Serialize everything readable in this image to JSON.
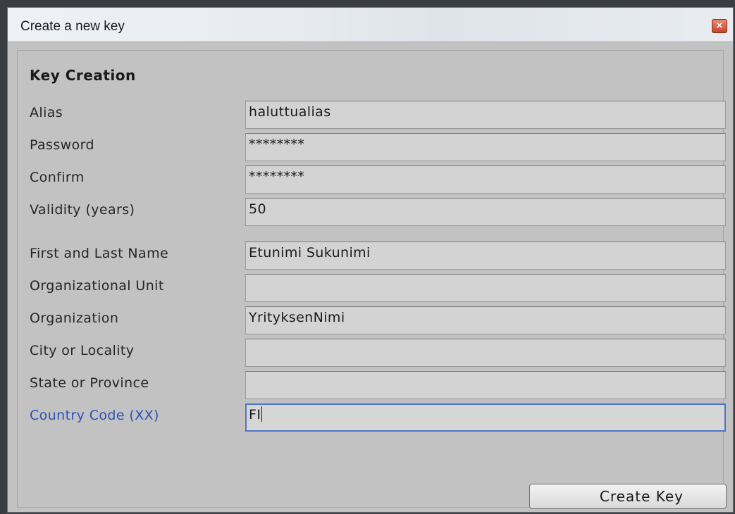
{
  "window": {
    "title": "Create a new key",
    "close_glyph": "×"
  },
  "section": {
    "heading": "Key Creation"
  },
  "fields": [
    {
      "label": "Alias",
      "value": "haluttualias"
    },
    {
      "label": "Password",
      "value": "********"
    },
    {
      "label": "Confirm",
      "value": "********"
    },
    {
      "label": "Validity (years)",
      "value": "50"
    },
    {
      "label": "First and Last Name",
      "value": "Etunimi Sukunimi"
    },
    {
      "label": "Organizational Unit",
      "value": ""
    },
    {
      "label": "Organization",
      "value": "YrityksenNimi"
    },
    {
      "label": "City or Locality",
      "value": ""
    },
    {
      "label": "State or Province",
      "value": ""
    },
    {
      "label": "Country Code (XX)",
      "value": "FI",
      "focused": true
    }
  ],
  "actions": {
    "create_label": "Create Key"
  },
  "colors": {
    "focus_accent": "#4f74c9",
    "focused_label": "#2b52b8",
    "close_button": "#c8452b"
  }
}
